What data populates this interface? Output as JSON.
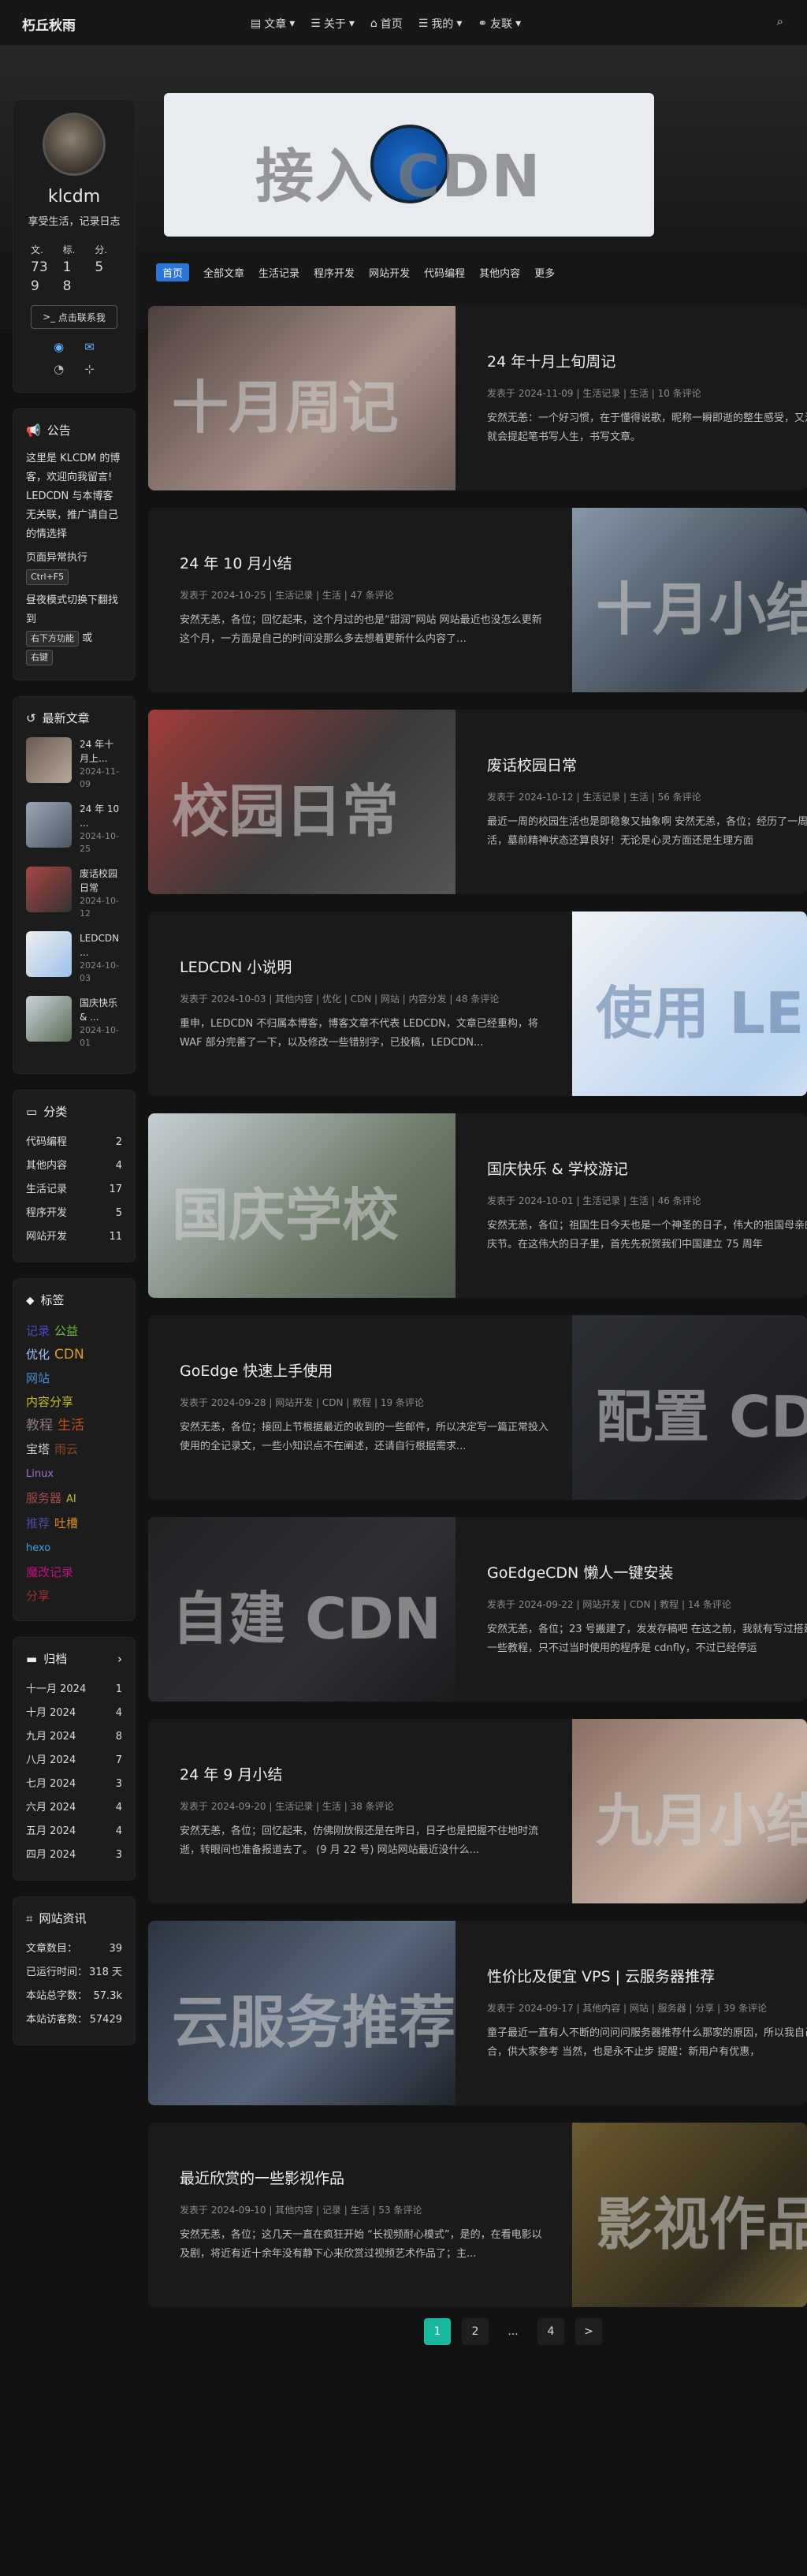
{
  "header": {
    "brand": "朽丘秋雨",
    "nav": [
      "文章",
      "关于",
      "首页",
      "我的",
      "友联"
    ]
  },
  "banner": {
    "text": "接入 CDN"
  },
  "categories_bar": [
    "首页",
    "全部文章",
    "生活记录",
    "程序开发",
    "网站开发",
    "代码编程",
    "其他内容",
    "更多"
  ],
  "author": {
    "name": "klcdm",
    "desc": "享受生活，记录日志",
    "stats_labels": [
      "文.",
      "标.",
      "分."
    ],
    "stats_values": [
      "73",
      "1",
      "5",
      "9",
      "8",
      ""
    ],
    "contact": "点击联系我"
  },
  "notice": {
    "title": "公告",
    "text1": "这里是 KLCDM 的博客，欢迎向我留言! LEDCDN 与本博客无关联，推广请自己的情选择",
    "text2": "页面异常执行",
    "key1": "Ctrl+F5",
    "text3": "昼夜模式切换下翻找到",
    "key2": "右下方功能",
    "or": "或",
    "key3": "右键"
  },
  "recent": {
    "title": "最新文章",
    "items": [
      {
        "t": "24 年十月上...",
        "d": "2024-11-09"
      },
      {
        "t": "24 年 10 ...",
        "d": "2024-10-25"
      },
      {
        "t": "废话校园日常",
        "d": "2024-10-12"
      },
      {
        "t": "LEDCDN ...",
        "d": "2024-10-03"
      },
      {
        "t": "国庆快乐 & ...",
        "d": "2024-10-01"
      }
    ]
  },
  "catlist": {
    "title": "分类",
    "items": [
      {
        "n": "代码编程",
        "c": "2"
      },
      {
        "n": "其他内容",
        "c": "4"
      },
      {
        "n": "生活记录",
        "c": "17"
      },
      {
        "n": "程序开发",
        "c": "5"
      },
      {
        "n": "网站开发",
        "c": "11"
      }
    ]
  },
  "tags": {
    "title": "标签",
    "items": [
      "记录",
      "公益",
      "优化",
      "CDN",
      "网站",
      "内容分享",
      "教程",
      "生活",
      "宝塔",
      "雨云",
      "Linux",
      "服务器",
      "AI",
      "推荐",
      "吐槽",
      "hexo",
      "魔改记录",
      "分享"
    ]
  },
  "archive": {
    "title": "归档",
    "items": [
      {
        "n": "十一月 2024",
        "c": "1"
      },
      {
        "n": "十月 2024",
        "c": "4"
      },
      {
        "n": "九月 2024",
        "c": "8"
      },
      {
        "n": "八月 2024",
        "c": "7"
      },
      {
        "n": "七月 2024",
        "c": "3"
      },
      {
        "n": "六月 2024",
        "c": "4"
      },
      {
        "n": "五月 2024",
        "c": "4"
      },
      {
        "n": "四月 2024",
        "c": "3"
      }
    ]
  },
  "siteinfo": {
    "title": "网站资讯",
    "items": [
      {
        "n": "文章数目：",
        "c": "39"
      },
      {
        "n": "已运行时间：",
        "c": "318 天"
      },
      {
        "n": "本站总字数：",
        "c": "57.3k"
      },
      {
        "n": "本站访客数：",
        "c": "57429"
      }
    ]
  },
  "posts": [
    {
      "title": "24 年十月上旬周记",
      "meta": "发表于 2024-11-09 | 生活记录 | 生活 | 10 条评论",
      "excerpt": "安然无恙：一个好习惯，在于懂得说歌，昵称一瞬即逝的整生感受，又没事情做，就会提起笔书写人生，书写文章。",
      "img": "十月周记"
    },
    {
      "title": "24 年 10 月小结",
      "meta": "发表于 2024-10-25 | 生活记录 | 生活 | 47 条评论",
      "excerpt": "安然无恙，各位；回忆起来，这个月过的也是“甜润”网站 网站最近也没怎么更新这个月，一方面是自己的时间没那么多去想着更新什么内容了…",
      "img": "十月小结"
    },
    {
      "title": "废话校园日常",
      "meta": "发表于 2024-10-12 | 生活记录 | 生活 | 56 条评论",
      "excerpt": "最近一周的校园生活也是即稳象又抽象啊 安然无恙，各位；经历了一周的校园生活，墓前精神状态还算良好！无论是心灵方面还是生理方面",
      "img": "校园日常"
    },
    {
      "title": "LEDCDN 小说明",
      "meta": "发表于 2024-10-03 | 其他内容 | 优化 | CDN | 网站 | 内容分发 | 48 条评论",
      "excerpt": "重申，LEDCDN 不归属本博客，博客文章不代表 LEDCDN，文章已经重构，将 WAF 部分完善了一下，以及修改一些错别字，已投稿，LEDCDN...",
      "img": "使用 LED"
    },
    {
      "title": "国庆快乐 & 学校游记",
      "meta": "发表于 2024-10-01 | 生活记录 | 生活 | 46 条评论",
      "excerpt": "安然无恙，各位；祖国生日今天也是一个神圣的日子，伟大的祖国母亲的生日，国庆节。在这伟大的日子里，首先先祝贺我们中国建立 75 周年",
      "img": "国庆学校"
    },
    {
      "title": "GoEdge 快速上手使用",
      "meta": "发表于 2024-09-28 | 网站开发 | CDN | 教程 | 19 条评论",
      "excerpt": "安然无恙，各位；接回上节根据最近的收到的一些邮件，所以决定写一篇正常投入使用的全记录文，一些小知识点不在阐述，还请自行根据需求...",
      "img": "配置 CDN"
    },
    {
      "title": "GoEdgeCDN 懒人一键安装",
      "meta": "发表于 2024-09-22 | 网站开发 | CDN | 教程 | 14 条评论",
      "excerpt": "安然无恙，各位；23 号搬建了，发发存稿吧 在这之前，我就有写过搭建 CDN 的一些教程，只不过当时使用的程序是 cdnfly，不过已经停运",
      "img": "自建 CDN"
    },
    {
      "title": "24 年 9 月小结",
      "meta": "发表于 2024-09-20 | 生活记录 | 生活 | 38 条评论",
      "excerpt": "安然无恙，各位；回忆起来，仿佛刚放假还是在昨日，日子也是把握不住地时流逝，转眼间也准备报道去了。 (9 月 22 号) 网站网站最近没什么...",
      "img": "九月小结"
    },
    {
      "title": "性价比及便宜 VPS | 云服务器推荐",
      "meta": "发表于 2024-09-17 | 其他内容 | 网站 | 服务器 | 分享 | 39 条评论",
      "excerpt": "童子最近一直有人不断的问问问服务器推荐什么那家的原因，所以我自己弄一个集合，供大家参考 当然，也是永不止步 提醒：新用户有优惠，",
      "img": "云服务推荐"
    },
    {
      "title": "最近欣赏的一些影视作品",
      "meta": "发表于 2024-09-10 | 其他内容 | 记录 | 生活 | 53 条评论",
      "excerpt": "安然无恙，各位；这几天一直在疯狂开始 “长视频耐心模式”，是的，在看电影以及剧，将近有近十余年没有静下心来欣赏过视频艺术作品了；主...",
      "img": "影视作品"
    }
  ],
  "pager": [
    "1",
    "2",
    "...",
    "4",
    ">"
  ]
}
